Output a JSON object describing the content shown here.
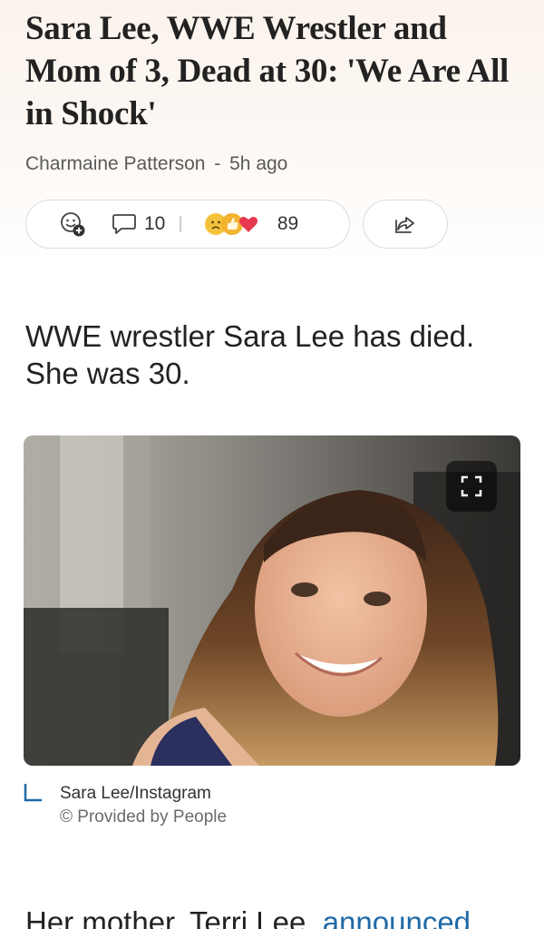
{
  "article": {
    "headline": "Sara Lee, WWE Wrestler and Mom of 3, Dead at 30: 'We Are All in Shock'",
    "author": "Charmaine Patterson",
    "separator": "-",
    "time_ago": "5h ago"
  },
  "actions": {
    "add_reaction_icon": "smiley-plus-icon",
    "comment_icon": "comment-bubble-icon",
    "comment_count": "10",
    "reactions": [
      "sad-face-icon",
      "thumbs-up-icon",
      "heart-icon"
    ],
    "reaction_count": "89",
    "share_icon": "share-icon"
  },
  "body": {
    "lede": "WWE wrestler Sara Lee has died. She was 30.",
    "paragraph_start": "Her mother, Terri Lee, ",
    "paragraph_link": "announced"
  },
  "image": {
    "expand_icon": "expand-icon",
    "credit": "Sara Lee/Instagram",
    "provider": "© Provided by People"
  },
  "colors": {
    "link": "#1f6aa8",
    "hero_bg": "#fbf3ec",
    "reaction_sad": "#f5c33b",
    "reaction_like": "#f2b431",
    "reaction_heart": "#e8384f"
  }
}
